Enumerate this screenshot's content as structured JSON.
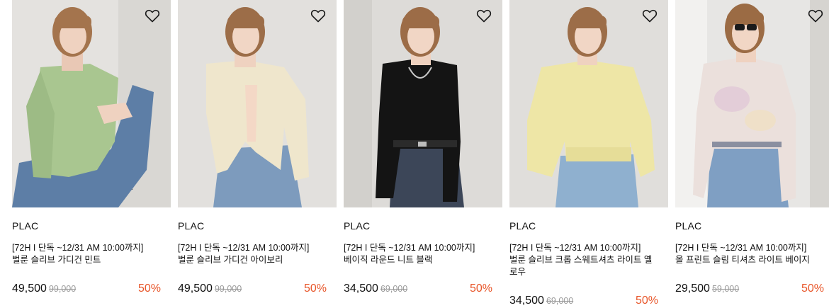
{
  "colors": {
    "discount": "#e8562a",
    "original_price": "#9a9a9a",
    "text": "#111111"
  },
  "products": [
    {
      "image": "model-wearing-mint-cardigan",
      "wishlist_icon": "heart-outline-icon",
      "brand": "PLAC",
      "promo": "[72H I 단독 ~12/31 AM 10:00까지]",
      "title": "벌룬 슬리브 가디건 민트",
      "price": "49,500",
      "original_price": "99,000",
      "discount": "50%"
    },
    {
      "image": "model-wearing-ivory-cardigan",
      "wishlist_icon": "heart-outline-icon",
      "brand": "PLAC",
      "promo": "[72H I 단독 ~12/31 AM 10:00까지]",
      "title": "벌룬 슬리브 가디건 아이보리",
      "price": "49,500",
      "original_price": "99,000",
      "discount": "50%"
    },
    {
      "image": "model-wearing-black-knit",
      "wishlist_icon": "heart-outline-icon",
      "brand": "PLAC",
      "promo": "[72H I 단독 ~12/31 AM 10:00까지]",
      "title": "베이직 라운드 니트 블랙",
      "price": "34,500",
      "original_price": "69,000",
      "discount": "50%"
    },
    {
      "image": "model-wearing-yellow-sweatshirt",
      "wishlist_icon": "heart-outline-icon",
      "brand": "PLAC",
      "promo": "[72H I 단독 ~12/31 AM 10:00까지]",
      "title": "벌룬 슬리브 크롭 스웨트셔츠 라이트 옐로우",
      "price": "34,500",
      "original_price": "69,000",
      "discount": "50%"
    },
    {
      "image": "model-wearing-beige-print-tee",
      "wishlist_icon": "heart-outline-icon",
      "brand": "PLAC",
      "promo": "[72H I 단독 ~12/31 AM 10:00까지]",
      "title": "올 프린트 슬림 티셔츠 라이트 베이지",
      "price": "29,500",
      "original_price": "59,000",
      "discount": "50%"
    }
  ]
}
